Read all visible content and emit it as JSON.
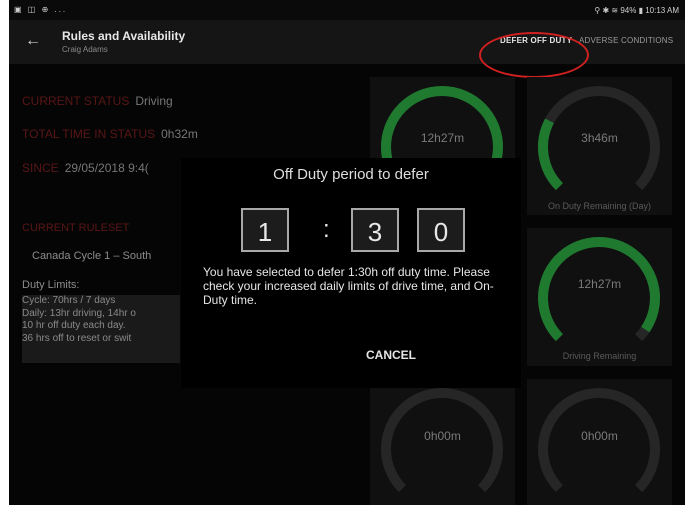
{
  "statusbar": {
    "left_icons": "▣ ◫ ⊕ ...",
    "right": "⚲ ✱ ≋ 94% ▮ 10:13 AM"
  },
  "appbar": {
    "back_icon": "←",
    "title": "Rules and Availability",
    "subtitle": "Craig Adams",
    "defer_label": "DEFER OFF DUTY",
    "adverse_label": "ADVERSE CONDITIONS"
  },
  "status": {
    "current_status_label": "CURRENT STATUS",
    "current_status_value": "Driving",
    "total_time_label": "TOTAL TIME IN STATUS",
    "total_time_value": "0h32m",
    "since_label": "SINCE",
    "since_value": "29/05/2018 9:4("
  },
  "ruleset": {
    "label": "CURRENT RULESET",
    "name": "Canada Cycle 1 – South"
  },
  "duty": {
    "header": "Duty Limits:",
    "lines": [
      "Cycle: 70hrs / 7 days",
      "Daily: 13hr driving, 14hr o",
      "10 hr off duty each day.",
      "36 hrs off to reset or swit"
    ]
  },
  "gauges": [
    {
      "value": "12h27m",
      "label": "",
      "fill": 1.0
    },
    {
      "value": "3h46m",
      "label": "On Duty Remaining (Day)",
      "fill": 0.27
    },
    {
      "value": "12h27m",
      "label": "Driving Remaining",
      "fill": 0.96
    },
    {
      "value": "0h00m",
      "label": "",
      "fill": 0.0
    },
    {
      "value": "0h00m",
      "label": "",
      "fill": 0.0
    }
  ],
  "dialog": {
    "title": "Off Duty period to defer",
    "digits": [
      "1",
      "3",
      "0"
    ],
    "colon": ":",
    "message": "You have selected to defer 1:30h off duty time. Please check your increased daily limits of drive time, and On-Duty time.",
    "cancel_label": "CANCEL"
  },
  "colors": {
    "accent": "#1f7a30",
    "track": "#262626",
    "highlight": "#d02020"
  }
}
